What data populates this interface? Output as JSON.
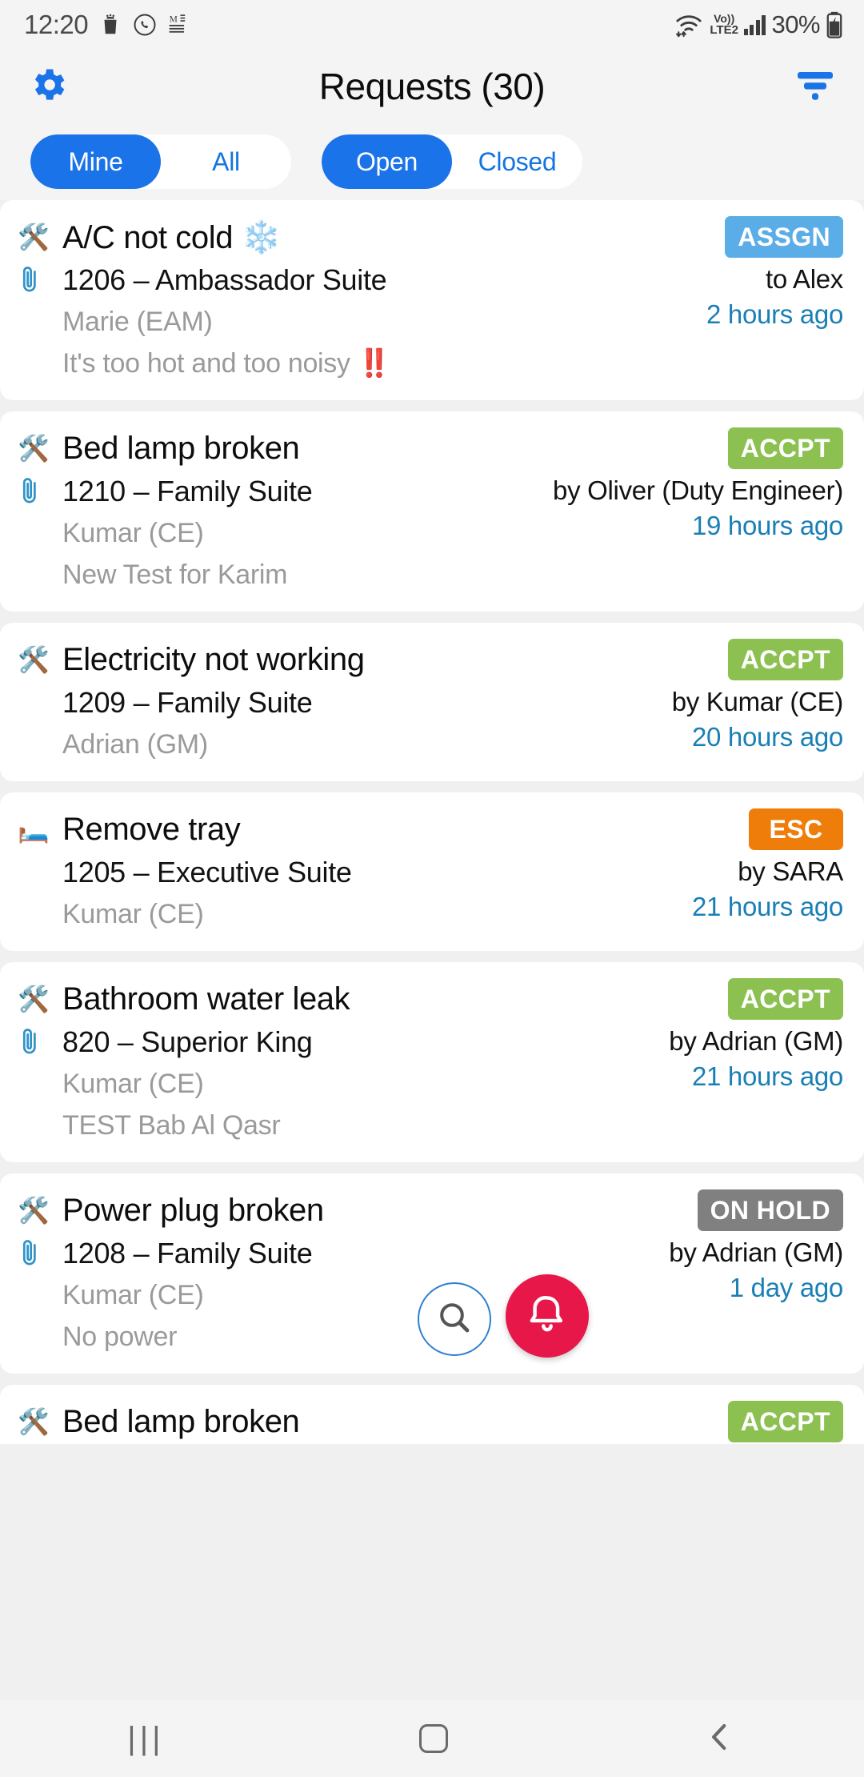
{
  "status_bar": {
    "time": "12:20",
    "battery_percent": "30%",
    "network_label_top": "Vo))",
    "network_label_bottom": "LTE2",
    "icons": [
      "android-trash-icon",
      "whatsapp-icon",
      "document-m-icon",
      "wifi-icon",
      "volte-icon",
      "signal-bars-icon",
      "battery-charging-icon"
    ]
  },
  "header": {
    "title": "Requests (30)",
    "settings_icon": "gear-icon",
    "filter_icon": "filter-icon"
  },
  "filters": {
    "scope": {
      "options": [
        "Mine",
        "All"
      ],
      "selected": "Mine"
    },
    "state": {
      "options": [
        "Open",
        "Closed"
      ],
      "selected": "Open"
    }
  },
  "colors": {
    "accent_blue": "#1a73e8",
    "badge_assign": "#5bade8",
    "badge_accept": "#8cc152",
    "badge_escalate": "#ef7d0a",
    "badge_onhold": "#808080",
    "time_link": "#1a7fb5",
    "muted_text": "#9a9a9a",
    "fab_bell": "#e8174a"
  },
  "requests": [
    {
      "type_icon": "tools-emoji",
      "title": "A/C not cold ❄️",
      "has_attachment": true,
      "attachment_icon": "paperclip-icon",
      "room": "1206 – Ambassador Suite",
      "requester": "Marie (EAM)",
      "note": "It's too hot and too noisy ‼️",
      "badge": "ASSGN",
      "badge_color": "#5bade8",
      "actor": "to Alex",
      "age": "2 hours ago"
    },
    {
      "type_icon": "tools-emoji",
      "title": "Bed lamp broken",
      "has_attachment": true,
      "attachment_icon": "paperclip-icon",
      "room": "1210 – Family Suite",
      "requester": "Kumar (CE)",
      "note": "New Test for Karim",
      "badge": "ACCPT",
      "badge_color": "#8cc152",
      "actor": "by Oliver (Duty Engineer)",
      "age": "19 hours ago"
    },
    {
      "type_icon": "tools-emoji",
      "title": "Electricity not working",
      "has_attachment": false,
      "attachment_icon": "",
      "room": "1209 – Family Suite",
      "requester": "Adrian (GM)",
      "note": "",
      "badge": "ACCPT",
      "badge_color": "#8cc152",
      "actor": "by Kumar (CE)",
      "age": "20 hours ago"
    },
    {
      "type_icon": "bed-emoji",
      "title": "Remove tray",
      "has_attachment": false,
      "attachment_icon": "",
      "room": "1205 – Executive Suite",
      "requester": "Kumar (CE)",
      "note": "",
      "badge": "ESC",
      "badge_color": "#ef7d0a",
      "actor": "by SARA",
      "age": "21 hours ago"
    },
    {
      "type_icon": "tools-emoji",
      "title": "Bathroom water leak",
      "has_attachment": true,
      "attachment_icon": "paperclip-icon",
      "room": "820 – Superior King",
      "requester": "Kumar (CE)",
      "note": "TEST Bab Al Qasr",
      "badge": "ACCPT",
      "badge_color": "#8cc152",
      "actor": "by Adrian (GM)",
      "age": "21 hours ago"
    },
    {
      "type_icon": "tools-emoji",
      "title": "Power plug broken",
      "has_attachment": true,
      "attachment_icon": "paperclip-icon",
      "room": "1208 – Family Suite",
      "requester": "Kumar (CE)",
      "note": "No power",
      "badge": "ON HOLD",
      "badge_color": "#808080",
      "actor": "by Adrian (GM)",
      "age": "1 day ago"
    },
    {
      "type_icon": "tools-emoji",
      "title": "Bed lamp broken",
      "has_attachment": false,
      "attachment_icon": "",
      "room": "",
      "requester": "",
      "note": "",
      "badge": "ACCPT",
      "badge_color": "#8cc152",
      "actor": "",
      "age": ""
    }
  ],
  "fabs": {
    "search": {
      "icon": "search-icon"
    },
    "notifications": {
      "icon": "bell-icon"
    }
  },
  "nav_bar": {
    "recents_icon": "recents-icon",
    "recents_glyph": "|||",
    "home_icon": "home-icon",
    "back_icon": "back-icon",
    "back_glyph": "‹"
  }
}
